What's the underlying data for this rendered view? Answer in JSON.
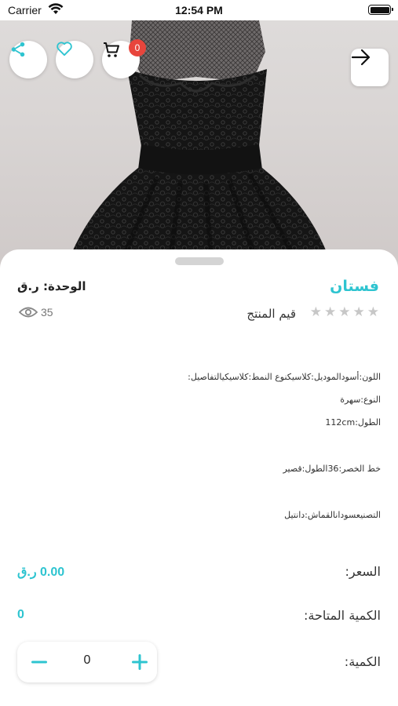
{
  "status_bar": {
    "carrier": "Carrier",
    "time": "12:54 PM"
  },
  "hero": {
    "icons": [
      "share-icon",
      "heart-icon",
      "cart-icon",
      "arrow-right-icon"
    ],
    "cart_count": "0"
  },
  "product": {
    "name": "فستان",
    "unit": "الوحدة: ر.ق",
    "rating_label": "قيم المنتج",
    "stars_total": 5,
    "rating": 0,
    "views": "35",
    "description_lines": [
      "اللون:أسودالموديل:كلاسيكنوع النمط:كلاسيكيالتفاصيل:",
      "النوع:سهرة",
      "الطول:112cm",
      "خط الخصر:36الطول:قصير",
      "التصنيعسودانالقماش:دانتيل"
    ]
  },
  "pricing": {
    "price_label": "السعر:",
    "price_value": "0.00 ر.ق",
    "available_label": "الكمية المتاحة:",
    "available_value": "0",
    "quantity_label": "الكمية:",
    "quantity_value": "0"
  },
  "colors": {
    "accent": "#2ec4d0",
    "badge": "#e8453c",
    "star_inactive": "#c7c7c7"
  }
}
